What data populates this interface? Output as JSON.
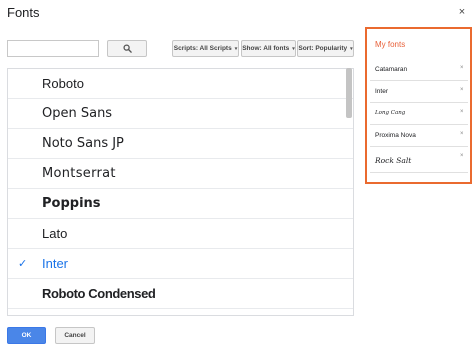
{
  "dialog": {
    "title": "Fonts",
    "close_icon": "close-icon",
    "close_glyph": "×"
  },
  "search": {
    "value": "",
    "placeholder": "",
    "button_icon": "search-icon"
  },
  "filters": {
    "scripts_label": "Scripts: All Scripts",
    "show_label": "Show: All fonts",
    "sort_label": "Sort: Popularity",
    "caret_glyph": "▾"
  },
  "font_list": {
    "check_glyph": "✓",
    "items": [
      {
        "label": "Roboto",
        "selected": false
      },
      {
        "label": "Open Sans",
        "selected": false
      },
      {
        "label": "Noto Sans JP",
        "selected": false
      },
      {
        "label": "Montserrat",
        "selected": false
      },
      {
        "label": "Poppins",
        "selected": false
      },
      {
        "label": "Lato",
        "selected": false
      },
      {
        "label": "Inter",
        "selected": true
      },
      {
        "label": "Roboto Condensed",
        "selected": false
      }
    ]
  },
  "my_fonts": {
    "title": "My fonts",
    "remove_glyph": "×",
    "items": [
      {
        "label": "Catamaran"
      },
      {
        "label": "Inter"
      },
      {
        "label": "Long Cang"
      },
      {
        "label": "Proxima Nova"
      },
      {
        "label": "Rock Salt"
      }
    ]
  },
  "footer": {
    "ok_label": "OK",
    "cancel_label": "Cancel"
  },
  "colors": {
    "accent_blue": "#1a73e8",
    "ok_button": "#4a86e8",
    "highlight_border": "#ea6a2f",
    "my_fonts_title": "#e8613a"
  }
}
